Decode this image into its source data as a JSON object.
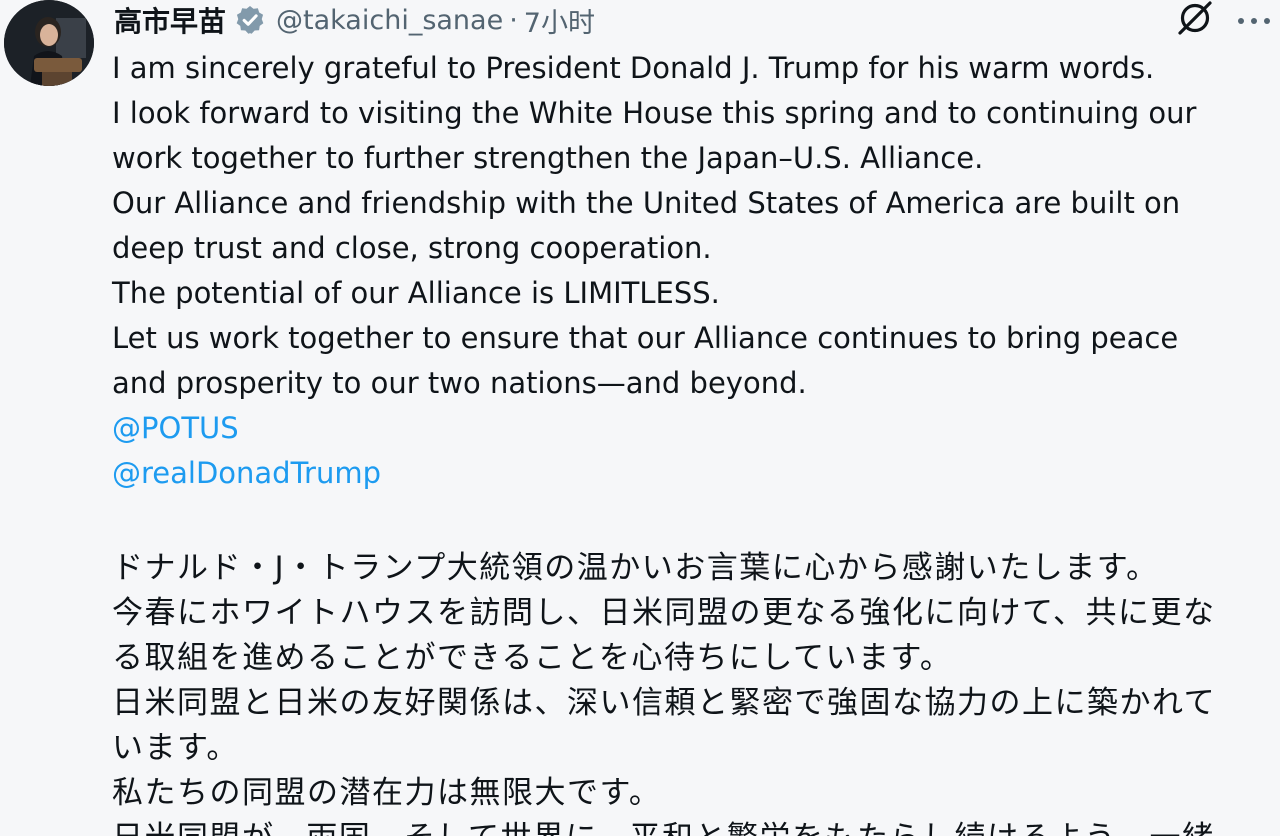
{
  "tweet": {
    "display_name": "高市早苗",
    "handle": "@takaichi_sanae",
    "separator": "·",
    "time_ago": "7小时",
    "english_lines": [
      "I am sincerely grateful to President Donald J. Trump for his warm words.",
      "I look forward to visiting the White House this spring and to continuing our",
      "work together to further strengthen the Japan–U.S. Alliance.",
      "Our Alliance and friendship with the United States of America are built on",
      "deep trust and close, strong cooperation.",
      "The potential of our Alliance is LIMITLESS.",
      "Let us work together to ensure that our Alliance continues to bring peace",
      "and prosperity to our two nations—and beyond."
    ],
    "mentions": [
      "@POTUS",
      "@realDonadTrump"
    ],
    "japanese_lines": [
      "ドナルド・J・トランプ大統領の温かいお言葉に心から感謝いたします。",
      "今春にホワイトハウスを訪問し、日米同盟の更なる強化に向けて、共に更な",
      "る取組を進めることができることを心待ちにしています。",
      "日米同盟と日米の友好関係は、深い信頼と緊密で強固な協力の上に築かれて",
      "います。",
      "私たちの同盟の潜在力は無限大です。",
      "日米同盟が、両国、そして世界に、平和と繁栄をもたらし続けるよう、一緒"
    ],
    "icons": {
      "verified": "verified-badge-icon",
      "grok": "grok-icon",
      "more": "more-horizontal-icon"
    },
    "colors": {
      "text": "#0f1419",
      "secondary": "#536471",
      "link": "#1d9bf0",
      "verified": "#829aab"
    }
  }
}
